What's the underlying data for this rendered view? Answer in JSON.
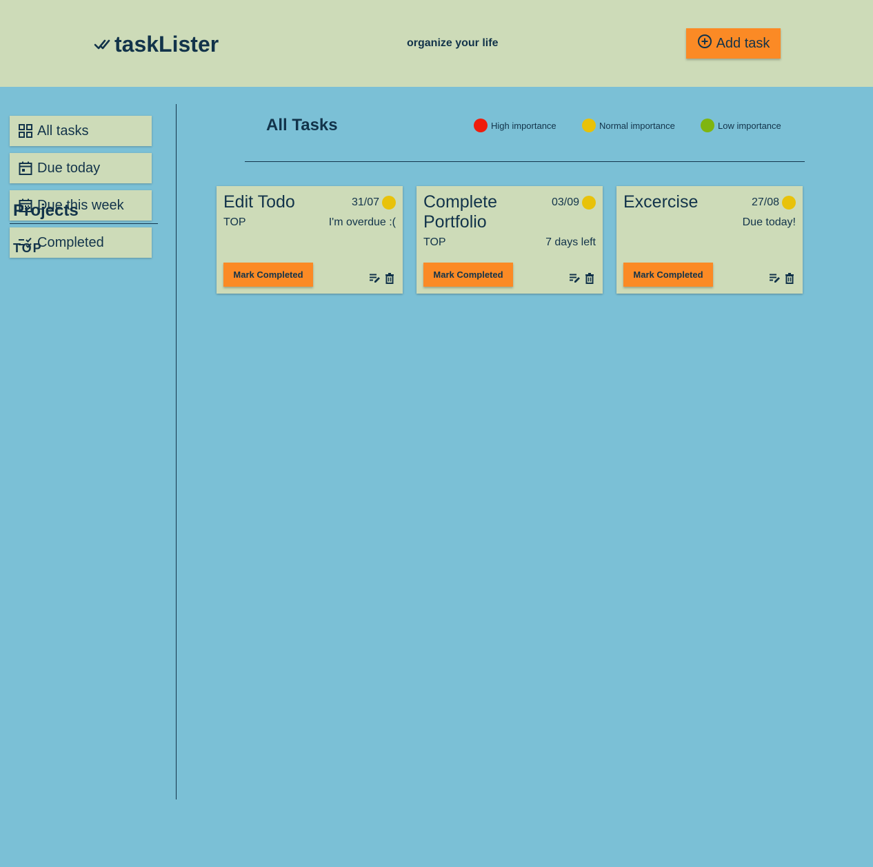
{
  "header": {
    "app_name": "taskLister",
    "tagline": "organize your life",
    "add_task_label": "Add task",
    "logo_icon": "done-all-icon",
    "add_icon": "add-circle-icon"
  },
  "sidebar": {
    "items": [
      {
        "label": "All tasks",
        "icon": "grid-icon"
      },
      {
        "label": "Due today",
        "icon": "calendar-today-icon"
      },
      {
        "label": "Due this week",
        "icon": "calendar-month-icon"
      },
      {
        "label": "Completed",
        "icon": "checklist-icon"
      }
    ],
    "projects_title": "Projects",
    "projects": [
      "TOP"
    ]
  },
  "main": {
    "title": "All Tasks",
    "legend": [
      {
        "label": "High importance",
        "color": "#ef1c0c"
      },
      {
        "label": "Normal importance",
        "color": "#e8c20a"
      },
      {
        "label": "Low importance",
        "color": "#7fb510"
      }
    ]
  },
  "tasks": [
    {
      "title": "Edit Todo",
      "date": "31/07",
      "project": "TOP",
      "status": "I'm overdue :(",
      "priority": "normal",
      "priority_color": "#e8c20a",
      "mark_label": "Mark Completed"
    },
    {
      "title": "Complete Portfolio",
      "date": "03/09",
      "project": "TOP",
      "status": "7 days left",
      "priority": "normal",
      "priority_color": "#e8c20a",
      "mark_label": "Mark Completed"
    },
    {
      "title": "Excercise",
      "date": "27/08",
      "project": "",
      "status": "Due today!",
      "priority": "normal",
      "priority_color": "#e8c20a",
      "mark_label": "Mark Completed"
    }
  ],
  "colors": {
    "background": "#7bc0d6",
    "panel": "#cddbb8",
    "accent": "#fb8a25",
    "text": "#12334a"
  }
}
